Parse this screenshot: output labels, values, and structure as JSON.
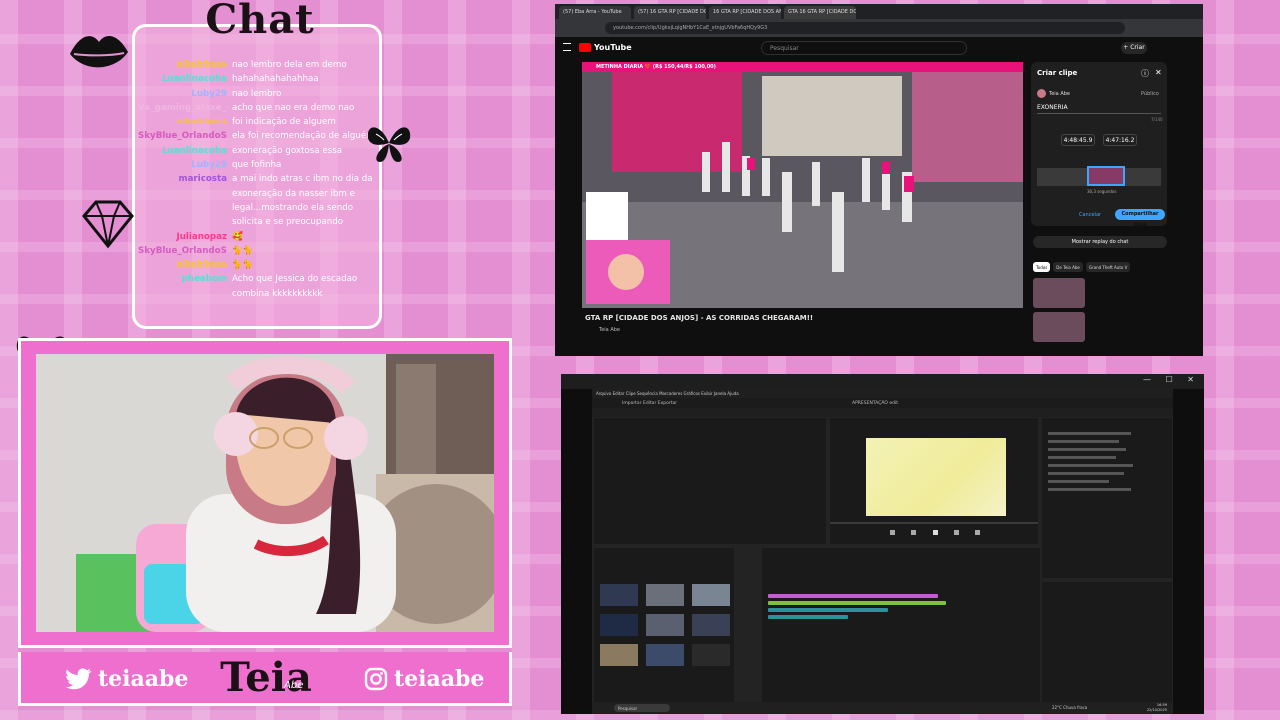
{
  "overlay": {
    "chat_title": "Chat",
    "brand": "Teia",
    "brand_signature": "Abe",
    "social_twitter": "teiaabe",
    "social_instagram": "teiaabe"
  },
  "chat": {
    "messages": [
      {
        "user": "nikolrboss",
        "text": "nao lembro dela em demo",
        "color": "#f7c23c"
      },
      {
        "user": "Luanlinacoha",
        "text": "hahahahahahahhaa",
        "color": "#56e0d6"
      },
      {
        "user": "Luby29",
        "text": "nao lembro",
        "color": "#9fb4ff"
      },
      {
        "user": "Vx_gaming_alaxe_ch",
        "text": "acho que nao era demo nao",
        "color": "#f0b6e0"
      },
      {
        "user": "nikolrboss",
        "text": "foi indicação de alguem",
        "color": "#f7c23c"
      },
      {
        "user": "SkyBlue_OrlandoSil...",
        "text": "ela foi recomendação de alguém",
        "color": "#d65cc0"
      },
      {
        "user": "Luanlinacoha",
        "text": "exoneração goxtosa essa",
        "color": "#56e0d6"
      },
      {
        "user": "Luby29",
        "text": "que fofinha",
        "color": "#9fb4ff"
      },
      {
        "user": "maricosta",
        "text": "a mai indo atras c ibm no dia da exoneração da nasser ibm e legal...mostrando ela sendo solicita e se preocupando",
        "color": "#a055d8"
      },
      {
        "user": "Julianopaz",
        "text": "🥰",
        "color": "#ff3a8a"
      },
      {
        "user": "SkyBlue_OrlandoSil...",
        "text": "🐈🐈",
        "color": "#d65cc0"
      },
      {
        "user": "nikolrboss",
        "text": "🐈🐈",
        "color": "#f7c23c"
      },
      {
        "user": "pheabom",
        "text": "Acho que Jessica do escadao combina kkkkkkkkkk",
        "color": "#56e0d6"
      }
    ]
  },
  "browser": {
    "tabs": [
      {
        "label": "(57) Eba Arra - YouTube"
      },
      {
        "label": "(57) 16 GTA RP [CIDADE DOS ANJOS]"
      },
      {
        "label": "16 GTA RP [CIDADE DOS ANJOS] - N..."
      },
      {
        "label": "GTA 16 GTA RP [CIDADE DOS AN..."
      }
    ],
    "url": "youtube.com/clip/UgkxjLqlgNHbY1CaE_xtnjgUVbFa6qHQy9G3",
    "yt_brand": "YouTube",
    "search_placeholder": "Pesquisar",
    "create_label": "+ Criar",
    "video_banner": "METINHA DIARIA ❤️ (R$ 150,44/R$ 100,00)",
    "video_title": "GTA RP [CIDADE DOS ANJOS] - AS CORRIDAS CHEGARAM!!",
    "channel": "Teia Abe",
    "clip_panel": {
      "title": "Criar clipe",
      "author": "Teia Abe",
      "visibility": "Público",
      "input_value": "EXONERIA",
      "char_count": "7/140",
      "start_time": "4:48:45.9",
      "end_time": "4:47:16.2",
      "duration": "30,3 segundos",
      "cancel_label": "Cancelar",
      "share_label": "Compartilhar clipe"
    },
    "replay_label": "Mostrar replay do chat",
    "chips": [
      "Todos",
      "De Teia Abe",
      "Grand Theft Auto V"
    ]
  },
  "premiere": {
    "window_title": "APRESENTAÇÃO edit",
    "menu": "Arquivo   Editar   Clipe   Sequência   Marcadores   Gráficos   Exibir   Janela   Ajuda",
    "nav": "Importar   Editar   Exportar",
    "taskbar_search": "Pesquisar",
    "weather": "22°C Chuva fraca",
    "clock_time": "16:59",
    "clock_date": "22/10/2025"
  }
}
